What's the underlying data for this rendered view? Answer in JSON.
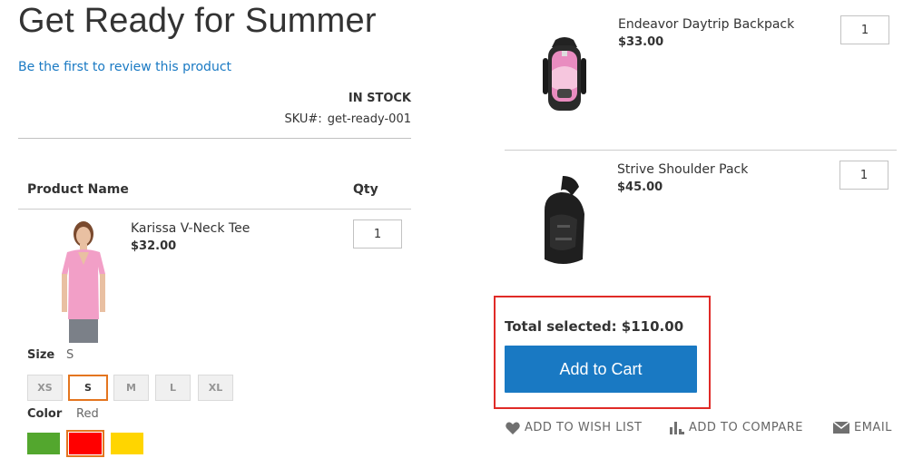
{
  "product": {
    "title": "Get Ready for Summer",
    "review_link": "Be the first to review this product",
    "stock": "IN STOCK",
    "sku_label": "SKU#:",
    "sku_value": "get-ready-001"
  },
  "table": {
    "col_name": "Product Name",
    "col_qty": "Qty"
  },
  "items": [
    {
      "name": "Karissa V-Neck Tee",
      "price": "$32.00",
      "qty": "1"
    },
    {
      "name": "Endeavor Daytrip Backpack",
      "price": "$33.00",
      "qty": "1"
    },
    {
      "name": "Strive Shoulder Pack",
      "price": "$45.00",
      "qty": "1"
    }
  ],
  "options": {
    "size_label": "Size",
    "size_value": "S",
    "sizes": [
      "XS",
      "S",
      "M",
      "L",
      "XL"
    ],
    "color_label": "Color",
    "color_value": "Red",
    "colors": [
      "#53a72e",
      "#ff0000",
      "#ffd500"
    ]
  },
  "summary": {
    "total": "Total selected: $110.00",
    "add_to_cart": "Add to Cart"
  },
  "actions": {
    "wishlist": "ADD TO WISH LIST",
    "compare": "ADD TO COMPARE",
    "email": "EMAIL"
  },
  "colors": {
    "accent": "#1979c3",
    "highlight": "#e02b27",
    "selected_border": "#e4751f"
  }
}
